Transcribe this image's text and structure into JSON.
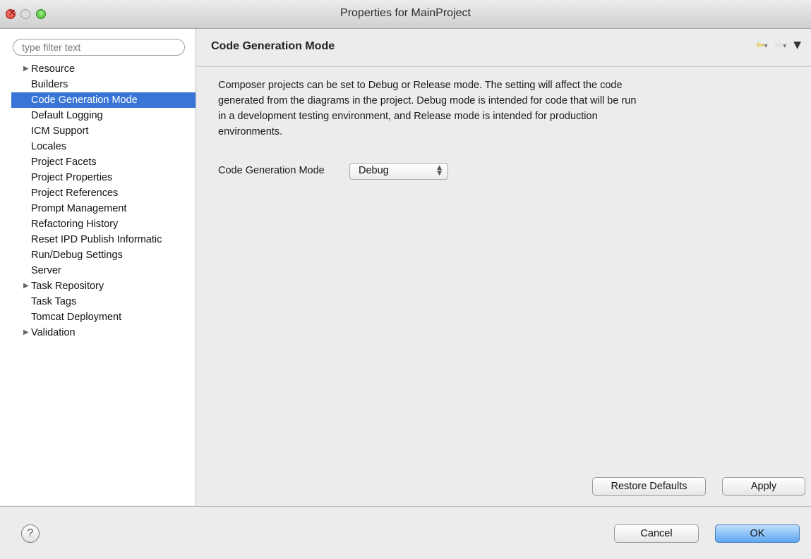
{
  "window": {
    "title": "Properties for MainProject"
  },
  "sidebar": {
    "filter_placeholder": "type filter text",
    "items": [
      {
        "label": "Resource",
        "expandable": true
      },
      {
        "label": "Builders"
      },
      {
        "label": "Code Generation Mode",
        "selected": true
      },
      {
        "label": "Default Logging"
      },
      {
        "label": "ICM Support"
      },
      {
        "label": "Locales"
      },
      {
        "label": "Project Facets"
      },
      {
        "label": "Project Properties"
      },
      {
        "label": "Project References"
      },
      {
        "label": "Prompt Management"
      },
      {
        "label": "Refactoring History"
      },
      {
        "label": "Reset IPD Publish Informatic"
      },
      {
        "label": "Run/Debug Settings"
      },
      {
        "label": "Server"
      },
      {
        "label": "Task Repository",
        "expandable": true
      },
      {
        "label": "Task Tags"
      },
      {
        "label": "Tomcat Deployment"
      },
      {
        "label": "Validation",
        "expandable": true
      }
    ]
  },
  "content": {
    "title": "Code Generation Mode",
    "description": "Composer projects can be set to Debug or Release mode.  The setting will affect the code generated from the diagrams in the project.  Debug mode is intended for code that will be run in a development testing environment, and Release mode is intended for production environments.",
    "mode_label": "Code Generation Mode",
    "mode_value": "Debug",
    "restore_label": "Restore Defaults",
    "apply_label": "Apply"
  },
  "footer": {
    "help_symbol": "?",
    "cancel_label": "Cancel",
    "ok_label": "OK"
  },
  "colors": {
    "selection": "#3875d7",
    "nav_back_arrow": "#e4b400",
    "ok_button": "#5fa6ef"
  },
  "icons": {
    "close": "close-icon",
    "minimize": "minimize-icon",
    "maximize": "maximize-icon",
    "back": "back-arrow-icon",
    "forward": "forward-arrow-icon",
    "view_menu": "view-menu-icon",
    "tree_expand": "triangle-right-icon",
    "select": "select-arrows-icon",
    "help": "help-icon"
  }
}
